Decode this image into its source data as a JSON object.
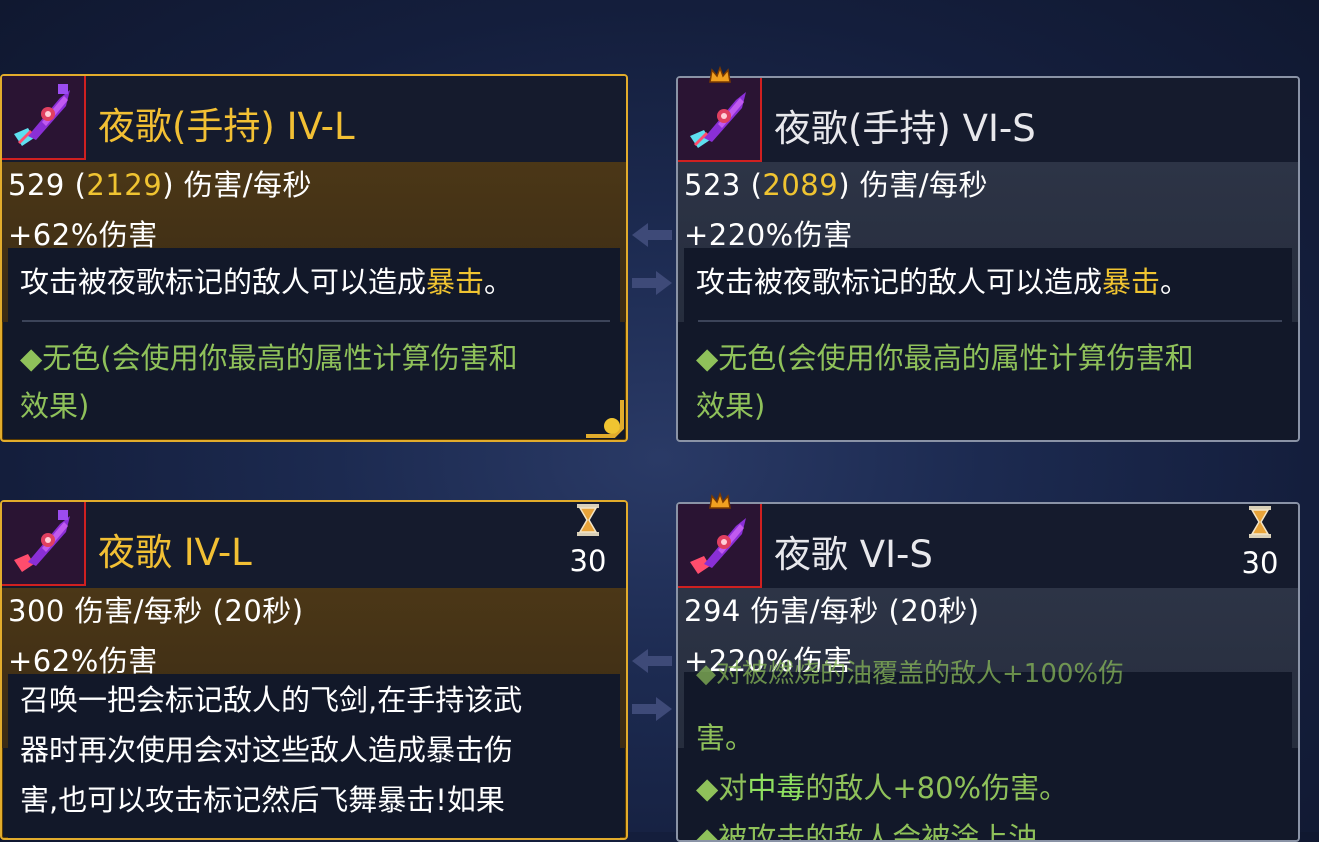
{
  "cards": [
    {
      "title": "夜歌(手持) IV-L",
      "dps": "529",
      "crit_dps": "2129",
      "dps_suffix": ") 伤害/每秒",
      "bonus": "+62%伤害",
      "effect_pre": "攻击被夜歌标记的敌人可以造成",
      "effect_crit": "暴击",
      "effect_post": "。",
      "scaling_line1": "◆无色(会使用你最高的属性计算伤害和",
      "scaling_line2": "效果)"
    },
    {
      "title": "夜歌(手持) VI-S",
      "dps": "523",
      "crit_dps": "2089",
      "dps_suffix": ") 伤害/每秒",
      "bonus": "+220%伤害",
      "effect_pre": "攻击被夜歌标记的敌人可以造成",
      "effect_crit": "暴击",
      "effect_post": "。",
      "scaling_line1": "◆无色(会使用你最高的属性计算伤害和",
      "scaling_line2": "效果)"
    },
    {
      "title": "夜歌 IV-L",
      "cooldown": "30",
      "dps_line": "300 伤害/每秒 (20秒)",
      "bonus": "+62%伤害",
      "desc_lines": [
        "召唤一把会标记敌人的飞剑,在手持该武",
        "器时再次使用会对这些敌人造成暴击伤",
        "害,也可以攻击标记然后飞舞暴击!如果"
      ]
    },
    {
      "title": "夜歌 VI-S",
      "cooldown": "30",
      "dps_line": "294 伤害/每秒 (20秒)",
      "bonus": "+220%伤害",
      "cut_line": "◆对被燃烧的油覆盖的敌人+100%伤",
      "cont_line": "害。",
      "poison_pre": "◆对",
      "poison_word": "中毒",
      "poison_post": "的敌人+80%伤害。",
      "last_line": "◆被攻击的敌人会被涂上油"
    }
  ],
  "colors": {
    "gold_border": "#e2ac2c",
    "grey_border": "#8a93a6",
    "crit_yellow": "#f0c431",
    "affix_green": "#8fc15a"
  },
  "icons": [
    "nightsong-sword-icon",
    "crown-icon",
    "hourglass-icon",
    "arrow-left-icon",
    "arrow-right-icon"
  ]
}
